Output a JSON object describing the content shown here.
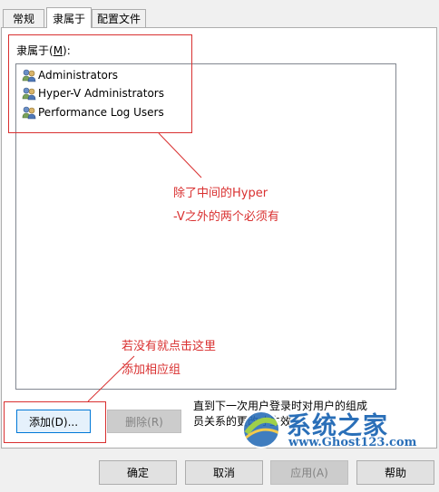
{
  "tabs": [
    {
      "label": "常规",
      "active": false
    },
    {
      "label": "隶属于",
      "active": true
    },
    {
      "label": "配置文件",
      "active": false
    }
  ],
  "member_of": {
    "label_prefix": "隶属于(",
    "label_key": "M",
    "label_suffix": "):",
    "items": [
      {
        "name": "Administrators",
        "icon": "group-users-icon"
      },
      {
        "name": "Hyper-V Administrators",
        "icon": "group-users-icon"
      },
      {
        "name": "Performance Log Users",
        "icon": "group-users-icon"
      }
    ]
  },
  "buttons": {
    "add": "添加(D)...",
    "remove": "删除(R)",
    "ok": "确定",
    "cancel": "取消",
    "apply": "应用(A)",
    "help": "帮助"
  },
  "note": "直到下一次用户登录时对用户的组成员关系的更改才生效。",
  "annotations": {
    "top_line1": "除了中间的Hyper",
    "top_line2": "-V之外的两个必须有",
    "bottom_line1": "若没有就点击这里",
    "bottom_line2": "添加相应组",
    "color": "#d93030"
  },
  "watermark": {
    "cn": "系统之家",
    "en": "www.Ghost123.com"
  }
}
